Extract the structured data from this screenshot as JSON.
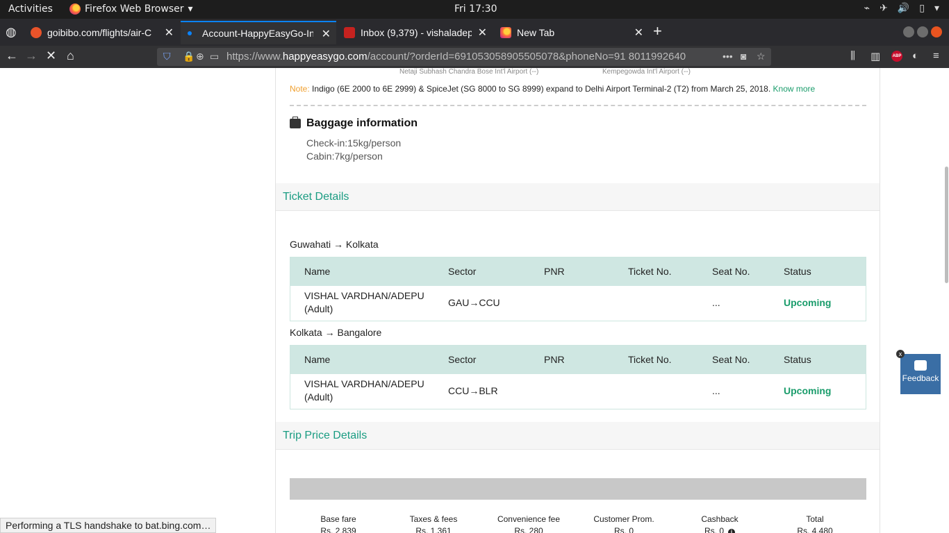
{
  "system_bar": {
    "activities": "Activities",
    "app_name": "Firefox Web Browser",
    "clock": "Fri 17:30"
  },
  "tabs": [
    {
      "title": "goibibo.com/flights/air-C",
      "active": false
    },
    {
      "title": "Account-HappyEasyGo-In",
      "active": true
    },
    {
      "title": "Inbox (9,379) - vishaladep",
      "active": false
    },
    {
      "title": "New Tab",
      "active": false
    }
  ],
  "address_bar": {
    "url_prefix": "https://www.",
    "url_host": "happyeasygo.com",
    "url_rest": "/account/?orderId=691053058905505078&phoneNo=91 8011992640"
  },
  "airports": {
    "from": "Netaji Subhash Chandra Bose Int'l Airport (--)",
    "to": "Kempegowda Int'l Airport (--)"
  },
  "note": {
    "label": "Note:",
    "text": "Indigo (6E 2000 to 6E 2999) & SpiceJet (SG 8000 to SG 8999) expand to Delhi Airport Terminal-2 (T2) from March 25, 2018.",
    "link": "Know more"
  },
  "baggage": {
    "title": "Baggage information",
    "checkin": "Check-in:15kg/person",
    "cabin": "Cabin:7kg/person"
  },
  "ticket_details": {
    "heading": "Ticket Details",
    "columns": [
      "Name",
      "Sector",
      "PNR",
      "Ticket No.",
      "Seat No.",
      "Status"
    ],
    "segments": [
      {
        "route": "Guwahati → Kolkata",
        "passenger": {
          "name_line1": "VISHAL VARDHAN/ADEPU",
          "name_line2": "(Adult)",
          "sector": "GAU→CCU",
          "pnr": "",
          "ticket_no": "",
          "seat_no": "...",
          "status": "Upcoming"
        }
      },
      {
        "route": "Kolkata → Bangalore",
        "passenger": {
          "name_line1": "VISHAL VARDHAN/ADEPU",
          "name_line2": "(Adult)",
          "sector": "CCU→BLR",
          "pnr": "",
          "ticket_no": "",
          "seat_no": "...",
          "status": "Upcoming"
        }
      }
    ]
  },
  "trip_price": {
    "heading": "Trip Price Details",
    "columns": [
      {
        "label": "Base fare",
        "value": "Rs. 2,839"
      },
      {
        "label": "Taxes & fees",
        "value": "Rs. 1,361"
      },
      {
        "label": "Convenience fee",
        "value": "Rs. 280"
      },
      {
        "label": "Customer Prom.",
        "value": "Rs. 0"
      },
      {
        "label": "Cashback",
        "value": "Rs. 0"
      },
      {
        "label": "Total",
        "value": "Rs. 4,480"
      }
    ]
  },
  "feedback": {
    "label": "Feedback",
    "close": "x"
  },
  "status_text": "Performing a TLS handshake to bat.bing.com…",
  "colors": {
    "accent_green": "#1a9c82",
    "table_header": "#cfe7e2",
    "status_upcoming": "#1a9c6b",
    "note_label": "#f0a030",
    "feedback_bg": "#3a6ea5"
  }
}
